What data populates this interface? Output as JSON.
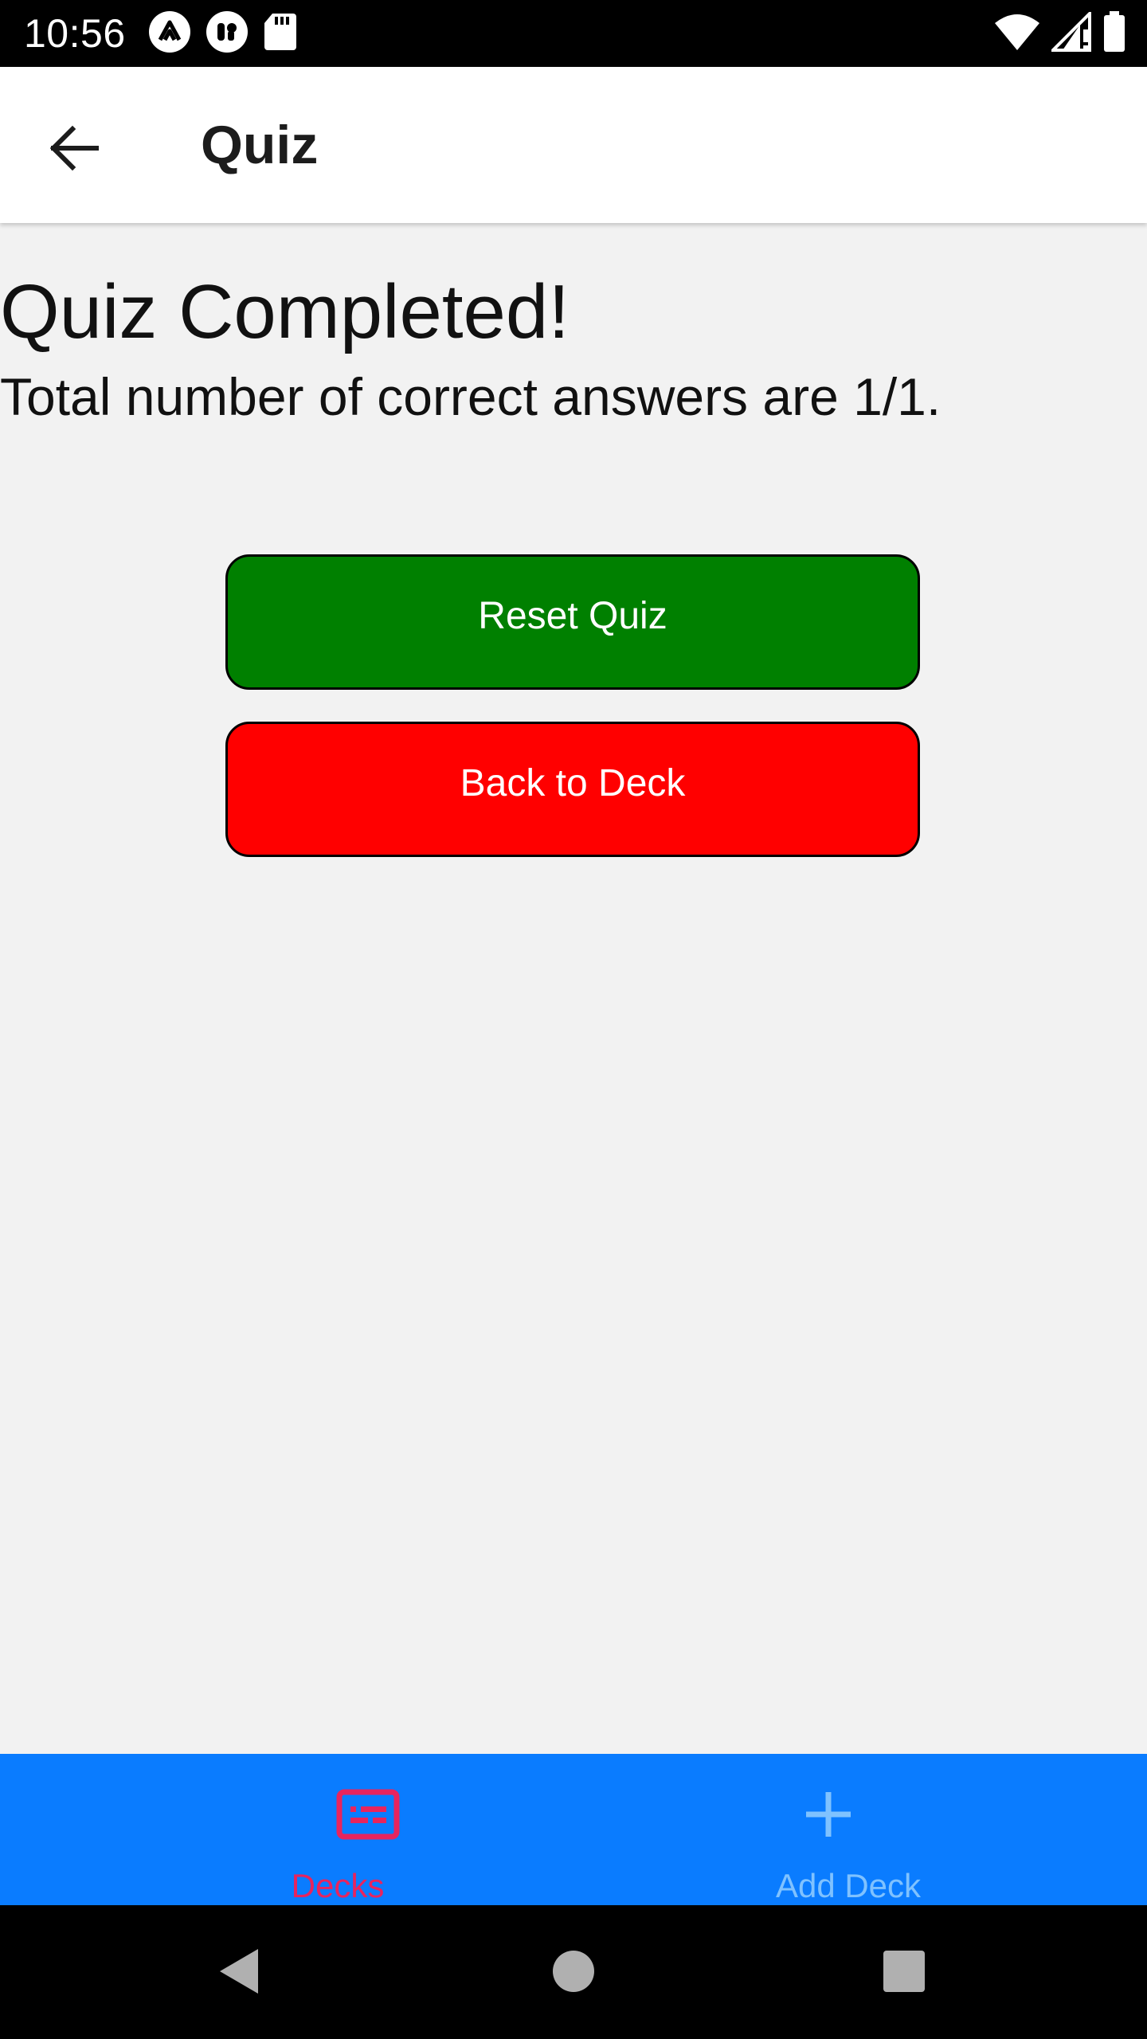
{
  "status_bar": {
    "time": "10:56",
    "left_icons": [
      "expo-icon",
      "notification-icon",
      "sd-card-icon"
    ],
    "right_icons": [
      "wifi-icon",
      "signal-icon",
      "battery-icon"
    ]
  },
  "app_bar": {
    "title": "Quiz",
    "back_icon": "arrow-left-icon"
  },
  "main": {
    "heading": "Quiz Completed!",
    "result_text": "Total number of correct answers are 1/1.",
    "buttons": {
      "reset_label": "Reset Quiz",
      "back_label": "Back to Deck"
    }
  },
  "tabs": [
    {
      "label": "Decks",
      "icon": "cards-icon",
      "active": true
    },
    {
      "label": "Add Deck",
      "icon": "plus-icon",
      "active": false
    }
  ],
  "nav_bar": {
    "buttons": [
      "nav-back",
      "nav-home",
      "nav-recents"
    ]
  },
  "colors": {
    "reset_button": "#008000",
    "back_button": "#ff0000",
    "tab_bar": "#0a7cff",
    "tab_active": "#e8245e",
    "tab_inactive": "#7fc2ff",
    "background": "#f2f2f2"
  }
}
